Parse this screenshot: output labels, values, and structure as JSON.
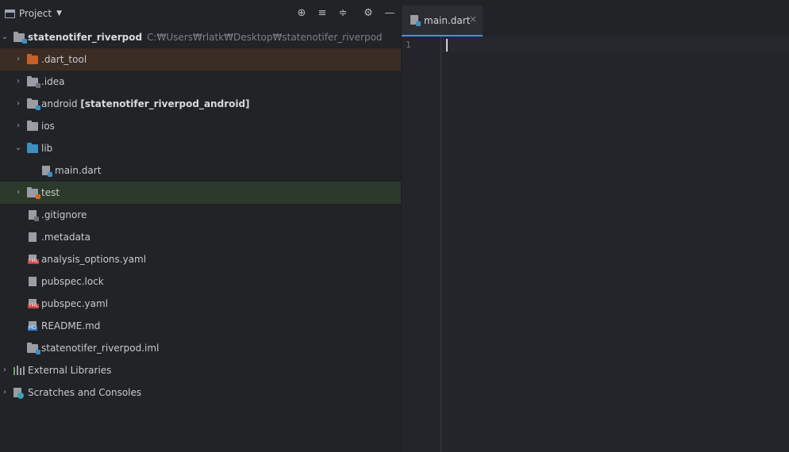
{
  "panel": {
    "title": "Project",
    "header_icons": [
      "locate-icon",
      "expand-all-icon",
      "collapse-all-icon",
      "gear-icon",
      "minimize-icon"
    ]
  },
  "tree": {
    "root": {
      "name": "statenotifer_riverpod",
      "path": "C:₩Users₩rlatk₩Desktop₩statenotifer_riverpod"
    },
    "dart_tool": ".dart_tool",
    "idea": ".idea",
    "android": {
      "name": "android",
      "module": "[statenotifer_riverpod_android]"
    },
    "ios": "ios",
    "lib": "lib",
    "main_dart": "main.dart",
    "test": "test",
    "gitignore": ".gitignore",
    "metadata": ".metadata",
    "analysis_options": "analysis_options.yaml",
    "pubspec_lock": "pubspec.lock",
    "pubspec_yaml": "pubspec.yaml",
    "readme": "README.md",
    "iml": "statenotifer_riverpod.iml",
    "external_libraries": "External Libraries",
    "scratches": "Scratches and Consoles"
  },
  "editor": {
    "tab_label": "main.dart",
    "tab_close": "×",
    "line_number": "1"
  },
  "colors": {
    "accent": "#4d8ee0",
    "dart_tool_highlight": "#3b2d24",
    "test_highlight": "#2b3a2b"
  }
}
